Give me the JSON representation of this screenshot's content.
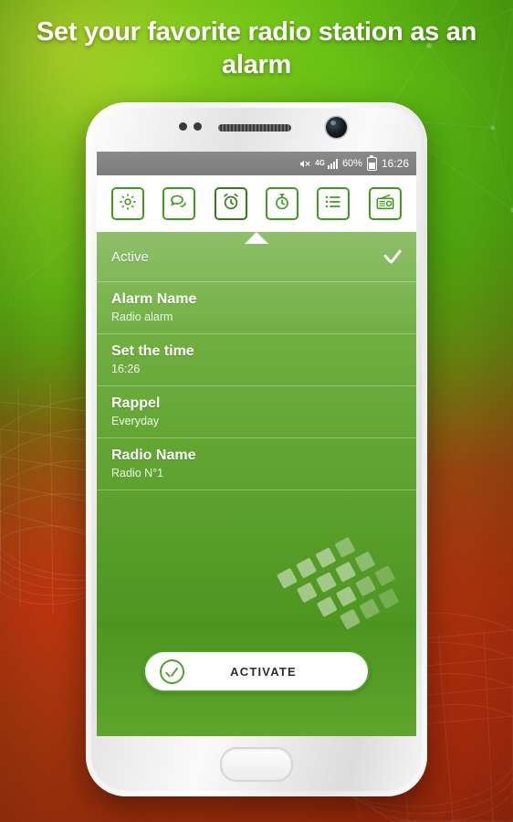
{
  "headline": "Set your favorite radio station as an alarm",
  "statusbar": {
    "mute_icon": "mute-icon",
    "network": "4G",
    "signal_icon": "signal-bars-icon",
    "battery_percent": "60%",
    "battery_icon": "battery-icon",
    "time": "16:26"
  },
  "toolbar": {
    "items": [
      {
        "name": "settings",
        "icon": "gear-icon",
        "label": "Settings",
        "active": false
      },
      {
        "name": "chat",
        "icon": "speech-bubble-icon",
        "label": "Chat",
        "active": false
      },
      {
        "name": "alarm",
        "icon": "alarm-clock-icon",
        "label": "Alarm",
        "active": true
      },
      {
        "name": "timer",
        "icon": "stopwatch-icon",
        "label": "Timer",
        "active": false
      },
      {
        "name": "list",
        "icon": "list-icon",
        "label": "List",
        "active": false
      },
      {
        "name": "radio",
        "icon": "radio-icon",
        "label": "Radio",
        "active": false
      }
    ]
  },
  "alarm_form": {
    "rows": [
      {
        "title": "Active",
        "value": "",
        "checked": true,
        "type": "toggle"
      },
      {
        "title": "Alarm Name",
        "value": "Radio alarm",
        "type": "field"
      },
      {
        "title": "Set the time",
        "value": "16:26",
        "type": "field"
      },
      {
        "title": "Rappel",
        "value": "Everyday",
        "type": "field"
      },
      {
        "title": "Radio Name",
        "value": "Radio N°1",
        "type": "field"
      }
    ],
    "activate_button": {
      "label": "ACTIVATE",
      "icon": "check-circle-icon"
    }
  },
  "colors": {
    "accent_green": "#3f9c1f",
    "panel_green_top": "#8ec06a",
    "panel_green_bottom": "#5fa52c",
    "button_border": "#4fa32b",
    "statusbar_gray": "#7c7c7c",
    "headline_text": "#ffffff"
  }
}
